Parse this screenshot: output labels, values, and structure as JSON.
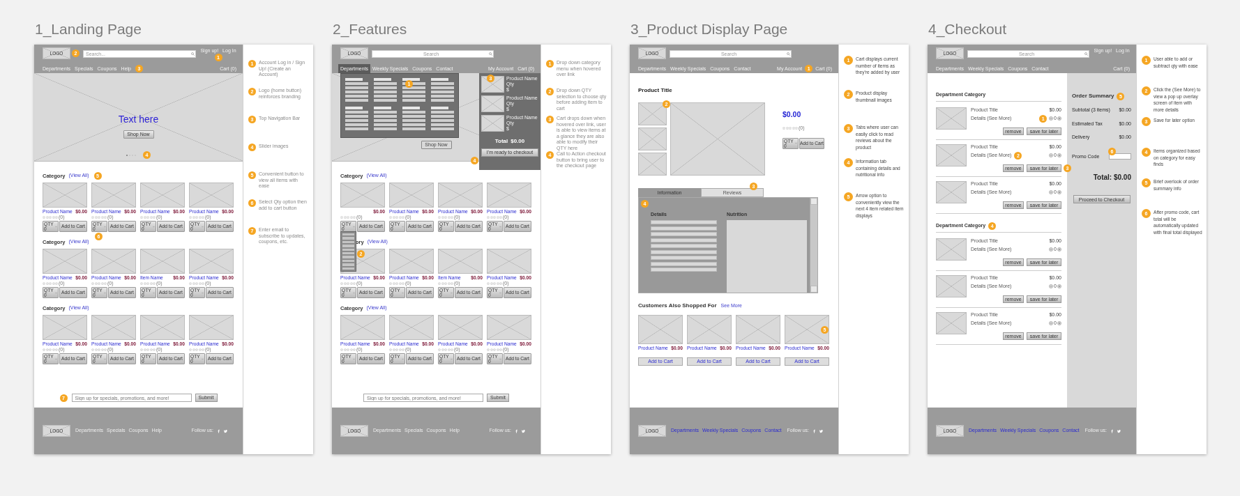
{
  "boards": [
    {
      "kind": "landing",
      "title": "1_Landing Page",
      "header": {
        "logo": "LOGO",
        "logo_callout": "2",
        "search": {
          "placeholder": "Search..."
        },
        "account_links": [
          "Sign up!",
          "Log In"
        ],
        "account_callout": "1",
        "nav": [
          {
            "label": "Departments"
          },
          {
            "label": "Specials"
          },
          {
            "label": "Coupons"
          },
          {
            "label": "Help"
          }
        ],
        "nav_callout": "3",
        "right_links": [
          "Cart (0)"
        ]
      },
      "hero": {
        "headline": "Text here",
        "button": "Shop Now",
        "dots": [
          {
            "selected": true
          },
          {
            "selected": false
          },
          {
            "selected": false
          },
          {
            "selected": false
          }
        ],
        "callout": "4"
      },
      "sections": [
        {
          "heading": "Category",
          "link": "(View All)",
          "callout": "5",
          "products": [
            {
              "name": "Product Name",
              "price": "$0.00",
              "stars": 0,
              "reviews": "(0)",
              "qty_label": "QTY",
              "qty": "0",
              "button": "Add to Cart"
            },
            {
              "name": "Product Name",
              "price": "$0.00",
              "stars": 0,
              "reviews": "(0)",
              "qty_label": "QTY",
              "qty": "0",
              "button": "Add to Cart",
              "callout": "6"
            },
            {
              "name": "Product Name",
              "price": "$0.00",
              "stars": 0,
              "reviews": "(0)",
              "qty_label": "QTY",
              "qty": "0",
              "button": "Add to Cart"
            },
            {
              "name": "Product Name",
              "price": "$0.00",
              "stars": 0,
              "reviews": "(0)",
              "qty_label": "QTY",
              "qty": "0",
              "button": "Add to Cart"
            }
          ]
        },
        {
          "heading": "Category",
          "link": "(View All)",
          "products": [
            {
              "name": "Product Name",
              "price": "$0.00",
              "stars": 0,
              "reviews": "(0)",
              "qty_label": "QTY",
              "qty": "0",
              "button": "Add to Cart"
            },
            {
              "name": "Product Name",
              "price": "$0.00",
              "stars": 0,
              "reviews": "(0)",
              "qty_label": "QTY",
              "qty": "0",
              "button": "Add to Cart"
            },
            {
              "name": "Item Name",
              "price": "$0.00",
              "stars": 0,
              "reviews": "(0)",
              "qty_label": "QTY",
              "qty": "0",
              "button": "Add to Cart"
            },
            {
              "name": "Product Name",
              "price": "$0.00",
              "stars": 0,
              "reviews": "(0)",
              "qty_label": "QTY",
              "qty": "0",
              "button": "Add to Cart"
            }
          ]
        },
        {
          "heading": "Category",
          "link": "(View All)",
          "products": [
            {
              "name": "Product Name",
              "price": "$0.00",
              "stars": 0,
              "reviews": "(0)",
              "qty_label": "QTY",
              "qty": "0",
              "button": "Add to Cart"
            },
            {
              "name": "Product Name",
              "price": "$0.00",
              "stars": 0,
              "reviews": "(0)",
              "qty_label": "QTY",
              "qty": "0",
              "button": "Add to Cart"
            },
            {
              "name": "Product Name",
              "price": "$0.00",
              "stars": 0,
              "reviews": "(0)",
              "qty_label": "QTY",
              "qty": "0",
              "button": "Add to Cart"
            },
            {
              "name": "Product Name",
              "price": "$0.00",
              "stars": 0,
              "reviews": "(0)",
              "qty_label": "QTY",
              "qty": "0",
              "button": "Add to Cart"
            }
          ]
        }
      ],
      "signup": {
        "placeholder": "Sign up for specials, promotions, and more!",
        "button": "Submit",
        "callout": "7"
      },
      "footer": {
        "logo": "LOGO",
        "links": [
          "Departments",
          "Specials",
          "Coupons",
          "Help"
        ],
        "follow": "Follow us:"
      },
      "notes": [
        {
          "number": "1",
          "text": "Account Log in / Sign Up! (Create an Account)"
        },
        {
          "number": "2",
          "text": "Logo (home button) reinforces branding"
        },
        {
          "number": "3",
          "text": "Top Navigation Bar"
        },
        {
          "number": "4",
          "text": "Slider images"
        },
        {
          "number": "5",
          "text": "Convenient button to view all items with ease"
        },
        {
          "number": "6",
          "text": "Select Qty option then add to cart button"
        },
        {
          "number": "7",
          "text": "Enter email to subscribe to updates, coupons, etc."
        }
      ]
    },
    {
      "kind": "features",
      "title": "2_Features",
      "header": {
        "logo": "LOGO",
        "search": {
          "placeholder": "Search"
        },
        "nav": [
          {
            "label": "Departments",
            "selected": true,
            "expanded": true,
            "callout": "1"
          },
          {
            "label": "Weekly Specials",
            "selected": false
          },
          {
            "label": "Coupons",
            "selected": false
          },
          {
            "label": "Contact",
            "selected": false
          }
        ],
        "right_links": [
          "My Account",
          "Cart (0)"
        ],
        "cart_dropdown": {
          "callout": "3",
          "items": [
            {
              "name": "Product Name",
              "qty": "Qty",
              "price": "$"
            },
            {
              "name": "Product Name",
              "qty": "Qty",
              "price": "$"
            },
            {
              "name": "Product Name",
              "qty": "Qty",
              "price": "$"
            }
          ],
          "total_label": "Total",
          "total": "$0.00",
          "button": "I'm ready to checkout",
          "button_callout": "4"
        }
      },
      "hero": {
        "button": "Shop Now"
      },
      "sections": [
        {
          "heading": "Category",
          "link": "(View All)",
          "products": [
            {
              "price": "$0.00",
              "stars": 0,
              "reviews": "(0)",
              "qty_label": "QTY",
              "qty": "0",
              "button": "Add to Cart",
              "expanded": true,
              "callout": "2"
            },
            {
              "name": "Product Name",
              "price": "$0.00",
              "stars": 0,
              "reviews": "(0)",
              "qty_label": "QTY",
              "qty": "0",
              "button": "Add to Cart"
            },
            {
              "name": "Product Name",
              "price": "$0.00",
              "stars": 0,
              "reviews": "(0)",
              "qty_label": "QTY",
              "qty": "0",
              "button": "Add to Cart"
            },
            {
              "name": "Product Name",
              "price": "$0.00",
              "stars": 0,
              "reviews": "(0)",
              "qty_label": "QTY",
              "qty": "0",
              "button": "Add to Cart"
            }
          ]
        },
        {
          "heading": "ory",
          "link": "(View All)",
          "products": [
            {
              "name": "Product Name",
              "price": "$0.00",
              "stars": 0,
              "reviews": "(0)",
              "qty_label": "QTY",
              "qty": "0",
              "button": "Add to Cart"
            },
            {
              "name": "Product Name",
              "price": "$0.00",
              "stars": 0,
              "reviews": "(0)",
              "qty_label": "QTY",
              "qty": "0",
              "button": "Add to Cart"
            },
            {
              "name": "Item Name",
              "price": "$0.00",
              "stars": 0,
              "reviews": "(0)",
              "qty_label": "QTY",
              "qty": "0",
              "button": "Add to Cart"
            },
            {
              "name": "Product Name",
              "price": "$0.00",
              "stars": 0,
              "reviews": "(0)",
              "qty_label": "QTY",
              "qty": "0",
              "button": "Add to Cart"
            }
          ]
        },
        {
          "heading": "Category",
          "link": "(View All)",
          "products": [
            {
              "name": "Product Name",
              "price": "$0.00",
              "stars": 0,
              "reviews": "(0)",
              "qty_label": "QTY",
              "qty": "0",
              "button": "Add to Cart"
            },
            {
              "name": "Product Name",
              "price": "$0.00",
              "stars": 0,
              "reviews": "(0)",
              "qty_label": "QTY",
              "qty": "0",
              "button": "Add to Cart"
            },
            {
              "name": "Product Name",
              "price": "$0.00",
              "stars": 0,
              "reviews": "(0)",
              "qty_label": "QTY",
              "qty": "0",
              "button": "Add to Cart"
            },
            {
              "name": "Product Name",
              "price": "$0.00",
              "stars": 0,
              "reviews": "(0)",
              "qty_label": "QTY",
              "qty": "0",
              "button": "Add to Cart"
            }
          ]
        }
      ],
      "signup": {
        "placeholder": "Sign up for specials, promotions, and more!",
        "button": "Submit"
      },
      "footer": {
        "logo": "LOGO",
        "links": [
          "Departments",
          "Specials",
          "Coupons",
          "Help"
        ],
        "follow": "Follow us:"
      },
      "notes": [
        {
          "number": "1",
          "text": "Drop down category menu when hovered over link"
        },
        {
          "number": "2",
          "text": "Drop down QTY selection to choose qty before adding item to cart"
        },
        {
          "number": "3",
          "text": "Cart drops down when hovered over link, user is able to view items at a glance they are also able to modify their QTY here"
        },
        {
          "number": "4",
          "text": "Call to Action checkout button to bring user to the checkout page"
        }
      ]
    },
    {
      "kind": "product",
      "title": "3_Product Display Page",
      "header": {
        "logo": "LOGO",
        "search": {
          "placeholder": "Search"
        },
        "nav": [
          {
            "label": "Departments"
          },
          {
            "label": "Weekly Specials"
          },
          {
            "label": "Coupons"
          },
          {
            "label": "Contact"
          }
        ],
        "right_links": [
          "My Account",
          "Cart (0)"
        ],
        "cart_callout": "1"
      },
      "product": {
        "title": "Product Title",
        "gallery_callout": "2",
        "price": "$0.00",
        "stars": 0,
        "reviews": "(0)",
        "qty_label": "QTY",
        "qty": "0",
        "button": "Add to Cart"
      },
      "tabs": [
        {
          "label": "Information",
          "selected": true
        },
        {
          "label": "Reviews",
          "selected": false,
          "callout": "3"
        }
      ],
      "panel": {
        "callout": "4",
        "details": "Details",
        "nutrition": "Nutrition"
      },
      "related": {
        "heading": "Customers Also Shopped For",
        "link": "See More",
        "arrow_callout": "5",
        "products": [
          {
            "name": "Product Name",
            "price": "$0.00",
            "button": "Add to Cart"
          },
          {
            "name": "Product Name",
            "price": "$0.00",
            "button": "Add to Cart"
          },
          {
            "name": "Product Name",
            "price": "$0.00",
            "button": "Add to Cart"
          },
          {
            "name": "Product Name",
            "price": "$0.00",
            "button": "Add to Cart"
          }
        ]
      },
      "footer": {
        "logo": "LOGO",
        "links": [
          "Departments",
          "Weekly Specials",
          "Coupons",
          "Contact"
        ],
        "follow": "Follow us:"
      },
      "notes": [
        {
          "number": "1",
          "text": "Cart displays current number of items as they're added by user"
        },
        {
          "number": "2",
          "text": "Product display thumbnail images"
        },
        {
          "number": "3",
          "text": "Tabs where user can easily click to read reviews about the product"
        },
        {
          "number": "4",
          "text": "Information tab containing details and nutritional info"
        },
        {
          "number": "5",
          "text": "Arrow option to conveniently view the next 4 item related item displays"
        }
      ]
    },
    {
      "kind": "checkout",
      "title": "4_Checkout",
      "header": {
        "logo": "LOGO",
        "search": {
          "placeholder": "Search"
        },
        "account_links": [
          "Sign up!",
          "Log In"
        ],
        "nav": [
          {
            "label": "Departments"
          },
          {
            "label": "Weekly Specials"
          },
          {
            "label": "Coupons"
          },
          {
            "label": "Contact"
          }
        ],
        "right_links": [
          "Cart (0)"
        ]
      },
      "cart": [
        {
          "heading": "Department Category",
          "items": [
            {
              "title": "Product Title",
              "details": "Details (See More)",
              "price": "$0.00",
              "qty": "0",
              "buttons": [
                "remove",
                "save for later"
              ],
              "qty_callout": "1"
            },
            {
              "title": "Product Title",
              "details": "Details (See More)",
              "price": "$0.00",
              "qty": "0",
              "buttons": [
                "remove",
                "save for later"
              ],
              "details_callout": "2",
              "buttons_callout": "3"
            },
            {
              "title": "Product Title",
              "details": "Details (See More)",
              "price": "$0.00",
              "qty": "0",
              "buttons": [
                "remove",
                "save for later"
              ]
            }
          ]
        },
        {
          "heading": "Department Category",
          "callout": "4",
          "items": [
            {
              "title": "Product Title",
              "details": "Details (See More)",
              "price": "$0.00",
              "qty": "0",
              "buttons": [
                "remove",
                "save for later"
              ]
            },
            {
              "title": "Product Title",
              "details": "Details (See More)",
              "price": "$0.00",
              "qty": "0",
              "buttons": [
                "remove",
                "save for later"
              ]
            },
            {
              "title": "Product Title",
              "details": "Details (See More)",
              "price": "$0.00",
              "qty": "0",
              "buttons": [
                "remove",
                "save for later"
              ]
            }
          ]
        }
      ],
      "summary": {
        "heading": "Order Summary",
        "callout": "5",
        "rows": [
          {
            "label": "Subtotal (3 items)",
            "value": "$0.00"
          },
          {
            "label": "Estimated Tax",
            "value": "$0.00"
          },
          {
            "label": "Delivery",
            "value": "$0.00"
          }
        ],
        "promo": {
          "label": "Promo Code",
          "callout": "6"
        },
        "total": "Total: $0.00",
        "button": "Proceed to Checkout"
      },
      "footer": {
        "logo": "LOGO",
        "links": [
          "Departments",
          "Weekly Specials",
          "Coupons",
          "Contact"
        ],
        "follow": "Follow us:"
      },
      "notes": [
        {
          "number": "1",
          "text": "User able to add or subtract qty with ease"
        },
        {
          "number": "2",
          "text": "Click the (See More) to view a pop up overlay screen of item with more details"
        },
        {
          "number": "3",
          "text": "Save for later option"
        },
        {
          "number": "4",
          "text": "Items organized based on category for easy finds"
        },
        {
          "number": "5",
          "text": "Brief overlook of order summary info"
        },
        {
          "number": "6",
          "text": "After promo code, cart total will be automatically updated with final total displayed"
        }
      ]
    }
  ]
}
